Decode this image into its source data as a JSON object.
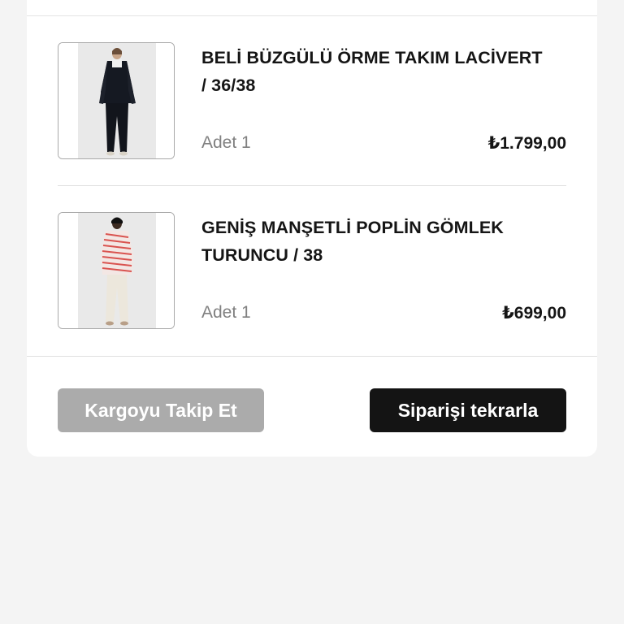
{
  "order": {
    "items": [
      {
        "title": "BELİ BÜZGÜLÜ ÖRME TAKIM LACİVERT / 36/38",
        "quantity": "Adet 1",
        "price": "₺1.799,00",
        "image": "product-photo-navy-knit-set"
      },
      {
        "title": "GENİŞ MANŞETLİ POPLİN GÖMLEK TURUNCU / 38",
        "quantity": "Adet 1",
        "price": "₺699,00",
        "image": "product-photo-striped-poplin-shirt"
      }
    ],
    "actions": {
      "track_label": "Kargoyu Takip Et",
      "reorder_label": "Siparişi tekrarla"
    }
  },
  "colors": {
    "page_background": "#f4f4f4",
    "card_background": "#ffffff",
    "primary_button": "#141414",
    "disabled_button": "#ababab",
    "muted_text": "#808080"
  }
}
